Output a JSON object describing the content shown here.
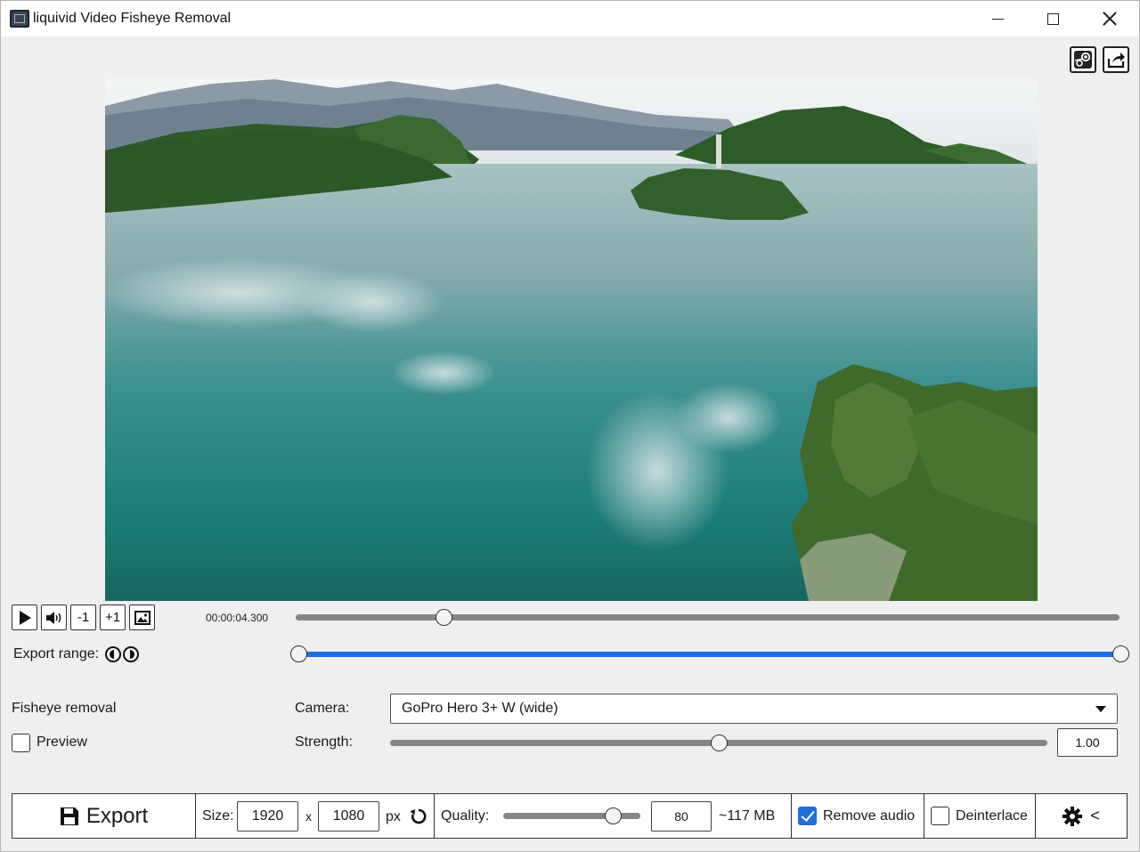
{
  "window": {
    "title": "liquivid Video Fisheye Removal",
    "controls": [
      "minimize",
      "maximize",
      "close"
    ]
  },
  "top_icons": [
    {
      "name": "steam-icon"
    },
    {
      "name": "share-icon"
    }
  ],
  "player": {
    "play_icon": "play-icon",
    "volume_icon": "volume-icon",
    "step_back_label": "-1",
    "step_forward_label": "+1",
    "snapshot_icon": "image-icon",
    "timecode": "00:00:04.300",
    "position_fraction": 0.18
  },
  "export_range": {
    "label": "Export range:",
    "start_fraction": 0.0,
    "end_fraction": 1.0,
    "start_icon": "range-start-icon",
    "end_icon": "range-end-icon",
    "accent_color": "#1e6fe0"
  },
  "fisheye": {
    "section_label": "Fisheye removal",
    "preview_label": "Preview",
    "preview_checked": false,
    "camera_label": "Camera:",
    "camera_value": "GoPro Hero 3+ W (wide)",
    "strength_label": "Strength:",
    "strength_value": "1.00",
    "strength_fraction": 0.5
  },
  "bottom": {
    "export_label": "Export",
    "size_label": "Size:",
    "width": "1920",
    "x_label": "x",
    "height": "1080",
    "px_label": "px",
    "quality_label": "Quality:",
    "quality_fraction": 0.8,
    "quality_value": "80",
    "estimated_size": "~117 MB",
    "remove_audio_label": "Remove audio",
    "remove_audio_checked": true,
    "deinterlace_label": "Deinterlace",
    "deinterlace_checked": false,
    "settings_caret": "<"
  }
}
